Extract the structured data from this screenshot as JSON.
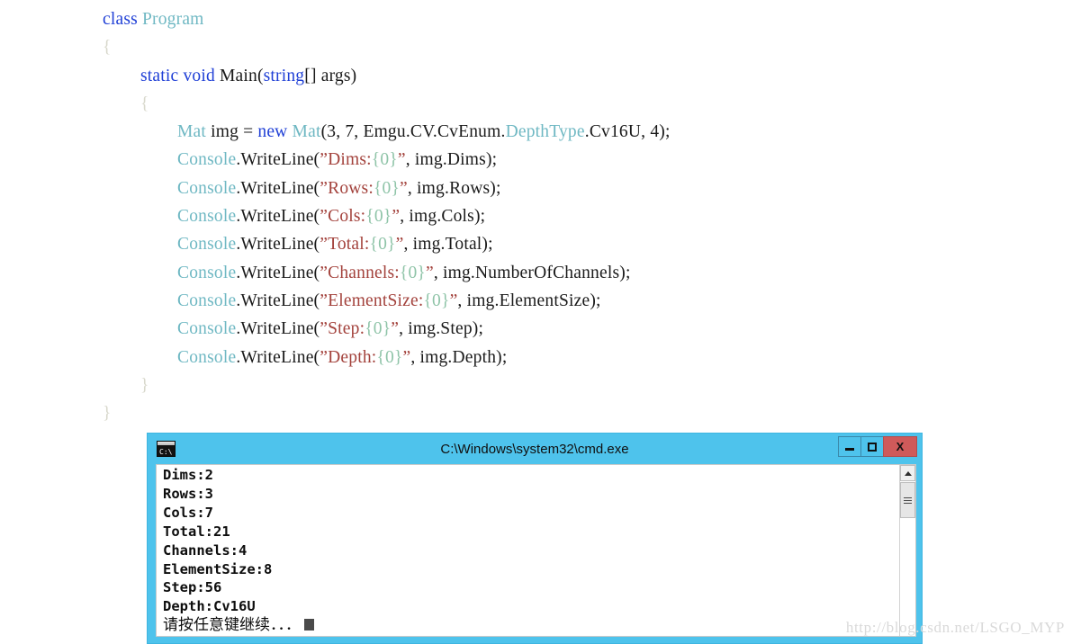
{
  "code": {
    "language": "csharp",
    "lines": [
      {
        "indent": 0,
        "tokens": [
          {
            "t": "class ",
            "c": "kw"
          },
          {
            "t": "Program",
            "c": "typ"
          }
        ]
      },
      {
        "indent": 0,
        "tokens": [
          {
            "t": "{",
            "c": "brc"
          }
        ]
      },
      {
        "indent": 1,
        "tokens": [
          {
            "t": "static",
            "c": "kw"
          },
          {
            "t": " ",
            "c": "pl"
          },
          {
            "t": "void",
            "c": "kw"
          },
          {
            "t": " Main(",
            "c": "pl"
          },
          {
            "t": "string",
            "c": "kw"
          },
          {
            "t": "[] args)",
            "c": "pl"
          }
        ]
      },
      {
        "indent": 1,
        "tokens": [
          {
            "t": "{",
            "c": "brc"
          }
        ]
      },
      {
        "indent": 2,
        "tokens": [
          {
            "t": "Mat",
            "c": "typ"
          },
          {
            "t": " img = ",
            "c": "pl"
          },
          {
            "t": "new",
            "c": "kw"
          },
          {
            "t": " ",
            "c": "pl"
          },
          {
            "t": "Mat",
            "c": "typ"
          },
          {
            "t": "(3, 7, Emgu.CV.CvEnum.",
            "c": "pl"
          },
          {
            "t": "DepthType",
            "c": "typ"
          },
          {
            "t": ".Cv16U, 4);",
            "c": "pl"
          }
        ]
      },
      {
        "indent": 2,
        "tokens": [
          {
            "t": "Console",
            "c": "typ"
          },
          {
            "t": ".WriteLine(",
            "c": "pl"
          },
          {
            "t": "”",
            "c": "qt"
          },
          {
            "t": "Dims:",
            "c": "str"
          },
          {
            "t": "{0}",
            "c": "fmt"
          },
          {
            "t": "”",
            "c": "qt"
          },
          {
            "t": ", img.Dims);",
            "c": "pl"
          }
        ]
      },
      {
        "indent": 2,
        "tokens": [
          {
            "t": "Console",
            "c": "typ"
          },
          {
            "t": ".WriteLine(",
            "c": "pl"
          },
          {
            "t": "”",
            "c": "qt"
          },
          {
            "t": "Rows:",
            "c": "str"
          },
          {
            "t": "{0}",
            "c": "fmt"
          },
          {
            "t": "”",
            "c": "qt"
          },
          {
            "t": ", img.Rows);",
            "c": "pl"
          }
        ]
      },
      {
        "indent": 2,
        "tokens": [
          {
            "t": "Console",
            "c": "typ"
          },
          {
            "t": ".WriteLine(",
            "c": "pl"
          },
          {
            "t": "”",
            "c": "qt"
          },
          {
            "t": "Cols:",
            "c": "str"
          },
          {
            "t": "{0}",
            "c": "fmt"
          },
          {
            "t": "”",
            "c": "qt"
          },
          {
            "t": ", img.Cols);",
            "c": "pl"
          }
        ]
      },
      {
        "indent": 2,
        "tokens": [
          {
            "t": "Console",
            "c": "typ"
          },
          {
            "t": ".WriteLine(",
            "c": "pl"
          },
          {
            "t": "”",
            "c": "qt"
          },
          {
            "t": "Total:",
            "c": "str"
          },
          {
            "t": "{0}",
            "c": "fmt"
          },
          {
            "t": "”",
            "c": "qt"
          },
          {
            "t": ", img.Total);",
            "c": "pl"
          }
        ]
      },
      {
        "indent": 2,
        "tokens": [
          {
            "t": "Console",
            "c": "typ"
          },
          {
            "t": ".WriteLine(",
            "c": "pl"
          },
          {
            "t": "”",
            "c": "qt"
          },
          {
            "t": "Channels:",
            "c": "str"
          },
          {
            "t": "{0}",
            "c": "fmt"
          },
          {
            "t": "”",
            "c": "qt"
          },
          {
            "t": ", img.NumberOfChannels);",
            "c": "pl"
          }
        ]
      },
      {
        "indent": 2,
        "tokens": [
          {
            "t": "Console",
            "c": "typ"
          },
          {
            "t": ".WriteLine(",
            "c": "pl"
          },
          {
            "t": "”",
            "c": "qt"
          },
          {
            "t": "ElementSize:",
            "c": "str"
          },
          {
            "t": "{0}",
            "c": "fmt"
          },
          {
            "t": "”",
            "c": "qt"
          },
          {
            "t": ", img.ElementSize);",
            "c": "pl"
          }
        ]
      },
      {
        "indent": 2,
        "tokens": [
          {
            "t": "Console",
            "c": "typ"
          },
          {
            "t": ".WriteLine(",
            "c": "pl"
          },
          {
            "t": "”",
            "c": "qt"
          },
          {
            "t": "Step:",
            "c": "str"
          },
          {
            "t": "{0}",
            "c": "fmt"
          },
          {
            "t": "”",
            "c": "qt"
          },
          {
            "t": ", img.Step);",
            "c": "pl"
          }
        ]
      },
      {
        "indent": 2,
        "tokens": [
          {
            "t": "Console",
            "c": "typ"
          },
          {
            "t": ".WriteLine(",
            "c": "pl"
          },
          {
            "t": "”",
            "c": "qt"
          },
          {
            "t": "Depth:",
            "c": "str"
          },
          {
            "t": "{0}",
            "c": "fmt"
          },
          {
            "t": "”",
            "c": "qt"
          },
          {
            "t": ", img.Depth);",
            "c": "pl"
          }
        ]
      },
      {
        "indent": 1,
        "tokens": [
          {
            "t": "}",
            "c": "brc"
          }
        ]
      },
      {
        "indent": 0,
        "tokens": [
          {
            "t": "}",
            "c": "brc"
          }
        ]
      }
    ]
  },
  "console_window": {
    "title": "C:\\Windows\\system32\\cmd.exe",
    "icon_name": "cmd-icon",
    "icon_glyph": "C:\\",
    "titlebar_color": "#4ec3ec",
    "close_button_color": "#cf5a5a",
    "buttons": [
      {
        "name": "minimize-button",
        "label": "–"
      },
      {
        "name": "maximize-button",
        "label": "□"
      },
      {
        "name": "close-button",
        "label": "X"
      }
    ],
    "output_lines": [
      "Dims:2",
      "Rows:3",
      "Cols:7",
      "Total:21",
      "Channels:4",
      "ElementSize:8",
      "Step:56",
      "Depth:Cv16U"
    ],
    "prompt_line": "请按任意键继续．．．",
    "scrollbar": {
      "up_arrow": "▲",
      "thumb_position_percent": 10
    }
  },
  "watermark": {
    "text": "http://blog.csdn.net/LSGO_MYP"
  }
}
